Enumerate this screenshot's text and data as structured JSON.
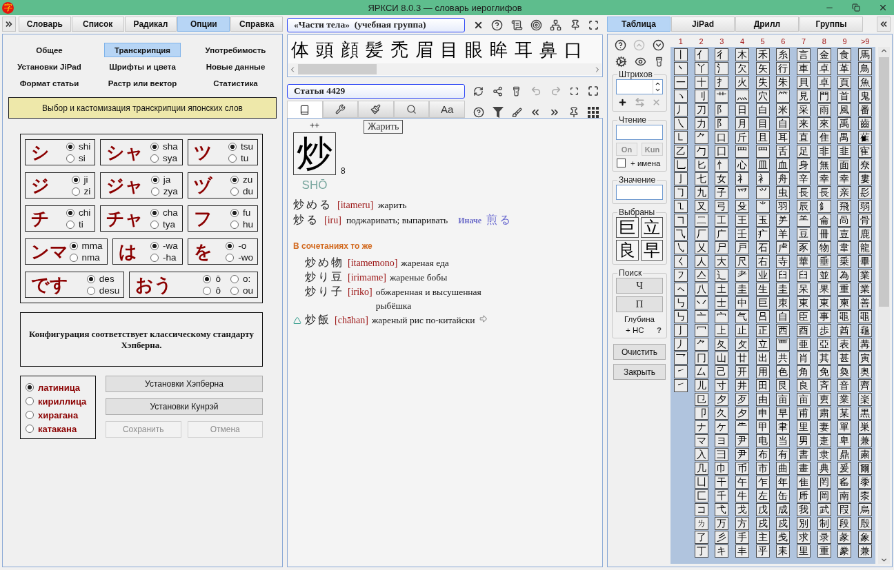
{
  "window": {
    "logo": "字",
    "title": "ЯРКСИ 8.0.3 — словарь иероглифов"
  },
  "left_panel": {
    "tabs": [
      {
        "label": "Словарь",
        "selected": false
      },
      {
        "label": "Список",
        "selected": false
      },
      {
        "label": "Радикал",
        "selected": false
      },
      {
        "label": "Опции",
        "selected": true
      },
      {
        "label": "Справка",
        "selected": false
      }
    ],
    "sections": [
      {
        "label": "Общее",
        "selected": false
      },
      {
        "label": "Транскрипция",
        "selected": true
      },
      {
        "label": "Употребимость",
        "selected": false
      },
      {
        "label": "Установки JiPad",
        "selected": false
      },
      {
        "label": "Шрифты и цвета",
        "selected": false
      },
      {
        "label": "Новые данные",
        "selected": false
      },
      {
        "label": "Формат статьи",
        "selected": false
      },
      {
        "label": "Растр или вектор",
        "selected": false
      },
      {
        "label": "Статистика",
        "selected": false
      }
    ],
    "banner": "Выбор и кастомизация транскрипции японских слов",
    "syllable_rows": [
      [
        {
          "kana": "シ",
          "options": [
            {
              "label": "shi",
              "selected": true
            },
            {
              "label": "si",
              "selected": false
            }
          ]
        },
        {
          "kana": "シャ",
          "options": [
            {
              "label": "sha",
              "selected": true
            },
            {
              "label": "sya",
              "selected": false
            }
          ]
        },
        {
          "kana": "ツ",
          "options": [
            {
              "label": "tsu",
              "selected": true
            },
            {
              "label": "tu",
              "selected": false
            }
          ]
        }
      ],
      [
        {
          "kana": "ジ",
          "options": [
            {
              "label": "ji",
              "selected": true
            },
            {
              "label": "zi",
              "selected": false
            }
          ]
        },
        {
          "kana": "ジャ",
          "options": [
            {
              "label": "ja",
              "selected": true
            },
            {
              "label": "zya",
              "selected": false
            }
          ]
        },
        {
          "kana": "ヅ",
          "options": [
            {
              "label": "zu",
              "selected": true
            },
            {
              "label": "du",
              "selected": false
            }
          ]
        }
      ],
      [
        {
          "kana": "チ",
          "options": [
            {
              "label": "chi",
              "selected": true
            },
            {
              "label": "ti",
              "selected": false
            }
          ]
        },
        {
          "kana": "チャ",
          "options": [
            {
              "label": "cha",
              "selected": true
            },
            {
              "label": "tya",
              "selected": false
            }
          ]
        },
        {
          "kana": "フ",
          "options": [
            {
              "label": "fu",
              "selected": true
            },
            {
              "label": "hu",
              "selected": false
            }
          ]
        }
      ],
      [
        {
          "kana": "ンマ",
          "options": [
            {
              "label": "mma",
              "selected": true
            },
            {
              "label": "nma",
              "selected": false
            }
          ]
        },
        {
          "kana": "は",
          "options": [
            {
              "label": "-wa",
              "selected": true
            },
            {
              "label": "-ha",
              "selected": false
            }
          ]
        },
        {
          "kana": "を",
          "options": [
            {
              "label": "-o",
              "selected": true
            },
            {
              "label": "-wo",
              "selected": false
            }
          ]
        }
      ],
      [
        {
          "kana": "です",
          "options": [
            {
              "label": "des",
              "selected": true
            },
            {
              "label": "desu",
              "selected": false
            }
          ]
        },
        {
          "kana": "おう",
          "options": [
            {
              "label": "ō",
              "selected": true
            },
            {
              "label": "ô",
              "selected": false
            },
            {
              "label": "o:",
              "selected": false
            },
            {
              "label": "ou",
              "selected": false
            }
          ]
        }
      ]
    ],
    "note": "Конфигурация соответствует классическому стандарту Хэпберна.",
    "scripts": [
      {
        "label": "латиница",
        "selected": true
      },
      {
        "label": "кириллица",
        "selected": false
      },
      {
        "label": "хирагана",
        "selected": false
      },
      {
        "label": "катакана",
        "selected": false
      }
    ],
    "buttons": [
      {
        "label": "Установки Хэпберна",
        "disabled": false
      },
      {
        "label": "Установки Кунрэй",
        "disabled": false
      },
      {
        "label": "Сохранить",
        "disabled": true
      },
      {
        "label": "Отмена",
        "disabled": true
      }
    ]
  },
  "middle_panel": {
    "group_title": "«Части тела»  (учебная группа)",
    "group_kanji": [
      "体",
      "頭",
      "顔",
      "髪",
      "禿",
      "眉",
      "目",
      "眼",
      "眸",
      "耳",
      "鼻",
      "口"
    ],
    "article_title": "Статья 4429",
    "article_tabs": [
      {
        "kind": "book",
        "selected": true
      },
      {
        "kind": "wrench",
        "selected": false
      },
      {
        "kind": "brush",
        "selected": false
      },
      {
        "kind": "search",
        "selected": false
      },
      {
        "kind": "text",
        "label": "Aa",
        "selected": false
      }
    ],
    "tooltip": "Жарить",
    "entry": {
      "marks": "++",
      "kanji": "炒",
      "strokes": "8",
      "reading": "SHŌ",
      "words": [
        {
          "word": "炒める",
          "romaji": "[itameru]",
          "meaning": "жарить"
        },
        {
          "word": "炒る",
          "romaji": "[iru]",
          "meaning": "поджаривать; выпаривать",
          "variant_label": "Иначе",
          "variant": "煎る"
        }
      ],
      "compounds_title": "В сочетаниях то же",
      "compounds": [
        {
          "word": "炒め物",
          "romaji": "[itamemono]",
          "meaning": "жареная еда",
          "marked": false,
          "linked": false
        },
        {
          "word": "炒り豆",
          "romaji": "[irimame]",
          "meaning": "жареные бобы",
          "marked": false,
          "linked": false
        },
        {
          "word": "炒り子",
          "romaji": "[iriko]",
          "meaning": "обжаренная и высушенная рыбёшка",
          "marked": false,
          "linked": false
        },
        {
          "word": "炒飯",
          "romaji": "[chāhan]",
          "meaning": "жареный рис по-китайски",
          "marked": true,
          "linked": true
        }
      ]
    }
  },
  "right_panel": {
    "tabs": [
      {
        "label": "Таблица",
        "selected": true
      },
      {
        "label": "JiPad",
        "selected": false
      },
      {
        "label": "Дрилл",
        "selected": false
      },
      {
        "label": "Группы",
        "selected": false
      }
    ],
    "strokes_label": "Штрихов",
    "reading_label": "Чтение",
    "reading_buttons": [
      {
        "label": "On",
        "disabled": true
      },
      {
        "label": "Kun",
        "disabled": true
      }
    ],
    "names": {
      "label": "+ имена",
      "checked": false
    },
    "meaning_label": "Значение",
    "chosen_label": "Выбраны",
    "chosen": [
      "巨",
      "立",
      "良",
      "早"
    ],
    "search_label": "Поиск",
    "search_buttons": [
      "Ч",
      "П"
    ],
    "depth_label": "Глубина",
    "depth_option": "+ НС",
    "depth_help": "?",
    "actions": [
      "Очистить",
      "Закрыть"
    ],
    "table": [
      {
        "heading": "1",
        "cells": [
          "丨",
          "丶",
          "一",
          "ヽ",
          "丿",
          "㇏",
          "㇄",
          "乙",
          "乚",
          "亅",
          "㇆",
          "㇅",
          "㇕",
          "⺄",
          "㇂",
          "㇛",
          "㇇",
          "ㇸ",
          "㇉",
          "㇉",
          "㇚",
          "㇓",
          "乛",
          "㇀",
          "㇀"
        ]
      },
      {
        "heading": "2",
        "cells": [
          "亻",
          "丫",
          "十",
          "刂",
          "刀",
          "力",
          "⺈",
          "勹",
          "匕",
          "七",
          "九",
          "又",
          "二",
          "厂",
          "乂",
          "人",
          "亼",
          "八",
          "丷",
          "亠",
          "冖",
          "⺈",
          "冂",
          "厶",
          "儿",
          "㔾",
          "卩",
          "ナ",
          "マ",
          "入",
          "几",
          "凵",
          "匚",
          "コ",
          "ㄌ",
          "了",
          "丁"
        ]
      },
      {
        "heading": "3",
        "cells": [
          "彳",
          "氵",
          "扌",
          "艹",
          "阝",
          "阝",
          "口",
          "囗",
          "忄",
          "女",
          "子",
          "弓",
          "工",
          "广",
          "尸",
          "大",
          "辶",
          "土",
          "士",
          "宀",
          "上",
          "夂",
          "山",
          "己",
          "寸",
          "夕",
          "久",
          "ケ",
          "ヨ",
          "彐",
          "巾",
          "干",
          "千",
          "弋",
          "万",
          "彡",
          "キ"
        ]
      },
      {
        "heading": "4",
        "cells": [
          "木",
          "欠",
          "火",
          "灬",
          "日",
          "月",
          "斤",
          "罒",
          "心",
          "礻",
          "爫",
          "殳",
          "王",
          "壬",
          "戸",
          "尺",
          "耂",
          "圭",
          "中",
          "气",
          "止",
          "攵",
          "廿",
          "开",
          "井",
          "歹",
          "夕",
          "⺧",
          "尹",
          "尹",
          "币",
          "午",
          "牛",
          "戈",
          "方",
          "手",
          "丰"
        ]
      },
      {
        "heading": "5",
        "cells": [
          "禾",
          "矢",
          "失",
          "穴",
          "白",
          "目",
          "且",
          "罒",
          "皿",
          "衤",
          "⺍",
          "⺌",
          "玉",
          "疒",
          "石",
          "右",
          "业",
          "生",
          "巨",
          "吕",
          "正",
          "立",
          "出",
          "用",
          "田",
          "由",
          "申",
          "甲",
          "电",
          "布",
          "市",
          "乍",
          "左",
          "戊",
          "戌",
          "主",
          "乎"
        ]
      },
      {
        "heading": "6",
        "cells": [
          "糸",
          "行",
          "朱",
          "⺮",
          "米",
          "自",
          "耳",
          "舌",
          "血",
          "舟",
          "虫",
          "羽",
          "⺶",
          "羊",
          "虍",
          "寺",
          "臼",
          "圭",
          "朿",
          "自",
          "西",
          "覀",
          "共",
          "色",
          "艮",
          "亩",
          "早",
          "聿",
          "当",
          "有",
          "曲",
          "年",
          "缶",
          "成",
          "戍",
          "戋",
          "耒"
        ]
      },
      {
        "heading": "7",
        "cells": [
          "言",
          "車",
          "貝",
          "見",
          "采",
          "来",
          "直",
          "足",
          "身",
          "辛",
          "長",
          "辰",
          "⺷",
          "豆",
          "豕",
          "華",
          "臼",
          "呆",
          "東",
          "臣",
          "酉",
          "亜",
          "肖",
          "角",
          "良",
          "亩",
          "甫",
          "里",
          "男",
          "書",
          "畫",
          "隹",
          "乕",
          "我",
          "別",
          "求",
          "里"
        ]
      },
      {
        "heading": "8",
        "cells": [
          "金",
          "卓",
          "卓",
          "門",
          "雨",
          "來",
          "隹",
          "非",
          "無",
          "幸",
          "長",
          "釒",
          "侖",
          "冊",
          "物",
          "垂",
          "並",
          "果",
          "東",
          "事",
          "歩",
          "亞",
          "其",
          "免",
          "斉",
          "叀",
          "粛",
          "妻",
          "疌",
          "隶",
          "典",
          "罔",
          "岡",
          "武",
          "制",
          "录",
          "重"
        ]
      },
      {
        "heading": "9",
        "cells": [
          "食",
          "革",
          "頁",
          "首",
          "風",
          "禹",
          "禺",
          "韭",
          "面",
          "幸",
          "亲",
          "飛",
          "咼",
          "壴",
          "韋",
          "乗",
          "為",
          "重",
          "柬",
          "黽",
          "酋",
          "表",
          "甚",
          "奐",
          "音",
          "業",
          "某",
          "單",
          "卑",
          "鼎",
          "爰",
          "䍃",
          "南",
          "叚",
          "段",
          "彖",
          "豢"
        ]
      },
      {
        "heading": ">9",
        "cells": [
          "馬",
          "鳥",
          "魚",
          "鬼",
          "番",
          "齒",
          "雈",
          "寉",
          "尞",
          "婁",
          "髟",
          "弱",
          "骨",
          "鹿",
          "龍",
          "畢",
          "業",
          "業",
          "善",
          "黽",
          "龜",
          "冓",
          "寅",
          "奥",
          "齊",
          "楽",
          "黒",
          "巣",
          "兼",
          "粛",
          "爾",
          "黍",
          "桼",
          "烏",
          "殷",
          "象",
          "兼"
        ]
      }
    ]
  }
}
